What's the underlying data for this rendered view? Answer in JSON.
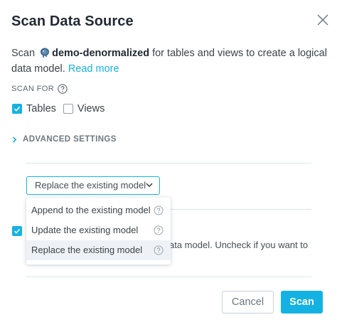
{
  "dialog": {
    "title": "Scan Data Source",
    "description": {
      "prefix": "Scan",
      "source_name": "demo-denormalized",
      "suffix": "for tables and views to create a logical data model.",
      "link": "Read more"
    },
    "scan_for_label": "SCAN FOR",
    "checks": [
      {
        "label": "Tables",
        "checked": true
      },
      {
        "label": "Views",
        "checked": false
      }
    ],
    "advanced_label": "ADVANCED SETTINGS",
    "select_value": "Replace the existing model",
    "behind_text_line1": "ata model. Uncheck if you want to",
    "behind_text_line2": "",
    "dropdown_items": [
      {
        "label": "Append to the existing model",
        "selected": false
      },
      {
        "label": "Update the existing model",
        "selected": false
      },
      {
        "label": "Replace the existing model",
        "selected": true
      }
    ],
    "buttons": {
      "cancel": "Cancel",
      "scan": "Scan"
    },
    "colors": {
      "accent": "#14b2e2",
      "title": "#222a33",
      "text": "#3b4249",
      "border": "#c9d2da"
    },
    "icons": {
      "close": "close-icon",
      "help": "question-circle-icon",
      "datasource": "postgres-elephant-icon",
      "chevron": "chevron-right-icon",
      "caret": "chevron-down-icon"
    }
  }
}
